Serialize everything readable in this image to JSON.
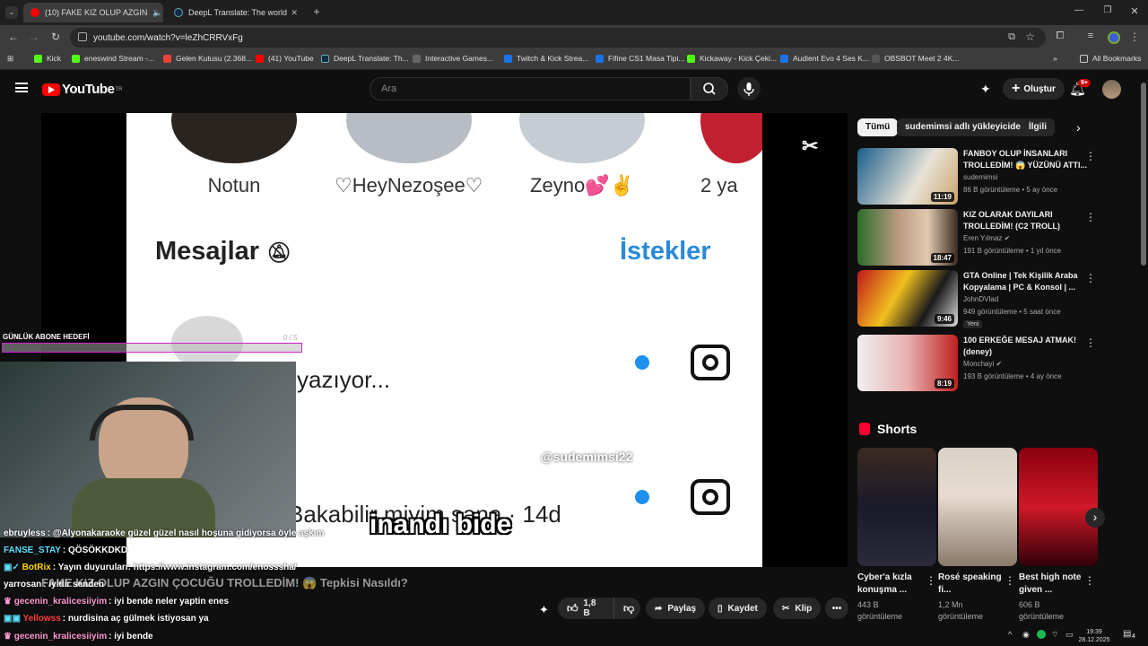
{
  "browser": {
    "tabs": [
      {
        "label": "(10) FAKE KIZ OLUP AZGIN",
        "favicon_color": "#ff0000",
        "active": true
      },
      {
        "label": "DeepL Translate: The world's m",
        "favicon_color": "#0f2b46",
        "active": false
      }
    ],
    "url": "youtube.com/watch?v=leZhCRRVxFg",
    "bookmarks": [
      {
        "label": "Kick",
        "color": "#53fc18"
      },
      {
        "label": "eneswind Stream -...",
        "color": "#53fc18"
      },
      {
        "label": "Gelen Kutusu (2.368...",
        "color": "#ea4335"
      },
      {
        "label": "(41) YouTube",
        "color": "#ff0000"
      },
      {
        "label": "DeepL Translate: Th...",
        "color": "#0f2b46"
      },
      {
        "label": "Interactive Games...",
        "color": "#333333"
      },
      {
        "label": "Twitch & Kick Strea...",
        "color": "#1a73e8"
      },
      {
        "label": "Fifine CS1 Masa Tipi...",
        "color": "#1a73e8"
      },
      {
        "label": "Kickaway - Kick Çeki...",
        "color": "#53fc18"
      },
      {
        "label": "Audient Evo 4 Ses K...",
        "color": "#1a73e8"
      },
      {
        "label": "OBSBOT Meet 2 4K...",
        "color": "#555555"
      }
    ],
    "all_bookmarks": "All Bookmarks"
  },
  "youtube": {
    "logo": "YouTube",
    "logo_sup": "TR",
    "search_placeholder": "Ara",
    "create_label": "Oluştur",
    "notif_count": "9+"
  },
  "video": {
    "story_names": [
      "Notun",
      "♡HeyNezoşee♡",
      "Zeyno💕✌",
      "2 ya"
    ],
    "mesajlar": "Mesajlar",
    "istekler": "İstekler",
    "typing": "yazıyor...",
    "msg2": "Bakabilir miyim sana · 14d",
    "watermark": "@sudemimsi22",
    "subtitle": "inandı bide",
    "goal_label": "GÜNLÜK ABONE HEDEFİ",
    "goal_count": "0 / 5",
    "goal_progress": 0
  },
  "chat": [
    {
      "user": "ebruyless",
      "color": "#ffffff",
      "text": "@Alyonakaraoke güzel güzel nasıl hoşuna gidiyorsa öyle aşkım"
    },
    {
      "user": "FANSE_STAY",
      "color": "#5fe0ff",
      "text": "QÖSÖKKDKD"
    },
    {
      "user": "BotRix",
      "color": "#ffd700",
      "text": "Yayın duyuruları: https://www.instagram.com/enosssha/"
    },
    {
      "user": "yarrosan",
      "color": "#ffffff",
      "text": "iyidir senden"
    },
    {
      "user": "gecenin_kralicesiiyim",
      "color": "#ff9ad5",
      "text": "iyi bende neler yaptin enes"
    },
    {
      "user": "Yellowss",
      "color": "#ff4040",
      "text": "nurdisina aç gülmek istiyosan ya"
    },
    {
      "user": "gecenin_kralicesiiyim",
      "color": "#ff9ad5",
      "text": "iyi bende"
    }
  ],
  "main": {
    "title": "FAKE KIZ OLUP AZGIN ÇOCUĞU TROLLEDİM! 😱 Tepkisi Nasıldı?",
    "like_count": "1,8 B",
    "share": "Paylaş",
    "save": "Kaydet",
    "clip": "Klip"
  },
  "chips": [
    "Tümü",
    "sudemimsi adlı yükleyiciden",
    "İlgili"
  ],
  "recommendations": [
    {
      "title": "FANBOY OLUP İNSANLARI TROLLEDİM! 😱 YÜZÜNÜ ATTI...",
      "channel": "sudemimsi",
      "meta": "86 B görüntüleme • 5 ay önce",
      "duration": "11:19",
      "badge": ""
    },
    {
      "title": "KIZ OLARAK DAYILARI TROLLEDİM! (C2 TROLL)",
      "channel": "Eren Yılmaz ✔",
      "meta": "191 B görüntüleme • 1 yıl önce",
      "duration": "18:47",
      "badge": ""
    },
    {
      "title": "GTA Online | Tek Kişilik Araba Kopyalama | PC & Konsol | ...",
      "channel": "JohnDVlad",
      "meta": "949 görüntüleme • 5 saat önce",
      "duration": "9:46",
      "badge": "Yeni"
    },
    {
      "title": "100 ERKEĞE MESAJ ATMAK! (deney)",
      "channel": "Monchayi ✔",
      "meta": "193 B görüntüleme • 4 ay önce",
      "duration": "8:19",
      "badge": ""
    }
  ],
  "shorts": {
    "heading": "Shorts",
    "items": [
      {
        "title": "Cyber'a kızla konuşma ...",
        "views": "443 B",
        "views2": "görüntüleme"
      },
      {
        "title": "Rosé speaking fi...",
        "views": "1,2 Mn",
        "views2": "görüntüleme"
      },
      {
        "title": "Best high note given ...",
        "views": "606 B",
        "views2": "görüntüleme"
      }
    ]
  },
  "taskbar": {
    "time": "19:39",
    "date": "28.12.2025",
    "notif": "4"
  }
}
